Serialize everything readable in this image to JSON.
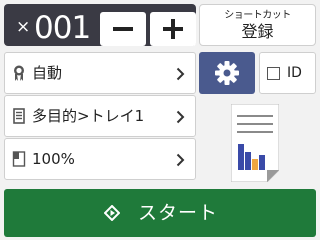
{
  "copy": {
    "times_symbol": "×",
    "count": "001",
    "minus_label": "−",
    "plus_label": "+"
  },
  "shortcut": {
    "line1": "ショートカット",
    "line2": "登録"
  },
  "settings": [
    {
      "icon": "quality-icon",
      "label": "自動"
    },
    {
      "icon": "tray-icon",
      "label": "多目的>トレイ1"
    },
    {
      "icon": "zoom-icon",
      "label": "100%"
    }
  ],
  "id_copy": {
    "label": "ID",
    "checked": false
  },
  "start": {
    "label": "スタート"
  },
  "colors": {
    "counter_bg": "#3a3a44",
    "settings_button": "#4a5a8e",
    "start_button": "#1f7a3a",
    "preview_bar_blue": "#3a4aa8",
    "preview_bar_orange": "#f0a640"
  }
}
